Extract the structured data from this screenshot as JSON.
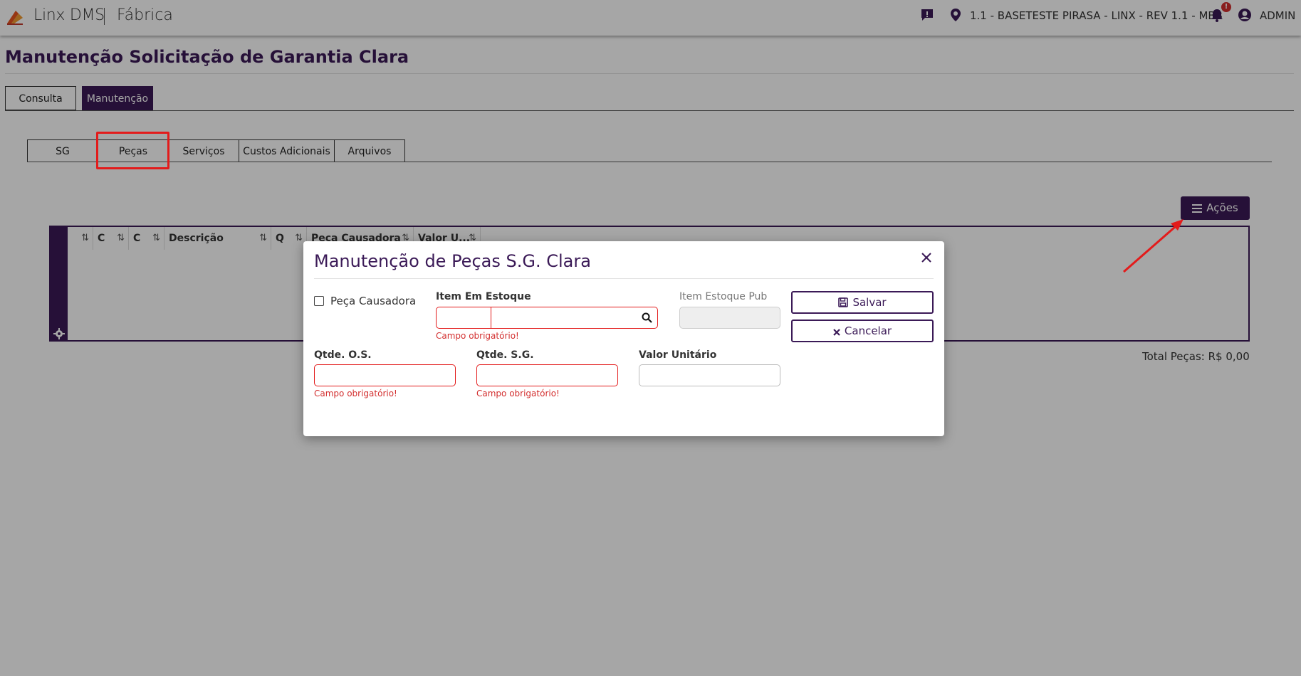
{
  "topbar": {
    "brand": "Linx DMS",
    "module": "Fábrica",
    "location": "1.1 - BASETESTE PIRASA - LINX - REV 1.1 - MBB",
    "notification_count": "!",
    "user": "ADMIN"
  },
  "page": {
    "title": "Manutenção Solicitação de Garantia Clara",
    "main_tabs": [
      "Consulta",
      "Manutenção"
    ],
    "active_main_tab": "Manutenção",
    "sub_tabs": [
      "SG",
      "Peças",
      "Serviços",
      "Custos Adicionais",
      "Arquivos"
    ],
    "highlighted_sub_tab": "Peças"
  },
  "actions_button": {
    "label": "Ações"
  },
  "grid": {
    "columns": [
      "",
      "C",
      "C",
      "Descrição",
      "Q",
      "Peça Causadora",
      "Valor U..."
    ],
    "sort_icon": "⇅"
  },
  "total": "Total Peças: R$ 0,00",
  "modal": {
    "title": "Manutenção de Peças S.G. Clara",
    "checkbox_label": "Peça Causadora",
    "item_estoque_label": "Item Em Estoque",
    "item_estoque_pub_label": "Item Estoque Pub",
    "qtde_os_label": "Qtde. O.S.",
    "qtde_sg_label": "Qtde. S.G.",
    "valor_unitario_label": "Valor Unitário",
    "required_error": "Campo obrigatório!",
    "save_label": "Salvar",
    "cancel_label": "Cancelar"
  },
  "colors": {
    "brand_purple": "#3b1a57",
    "error_red": "#e31b1b",
    "annotation_red": "#e31b1b"
  }
}
